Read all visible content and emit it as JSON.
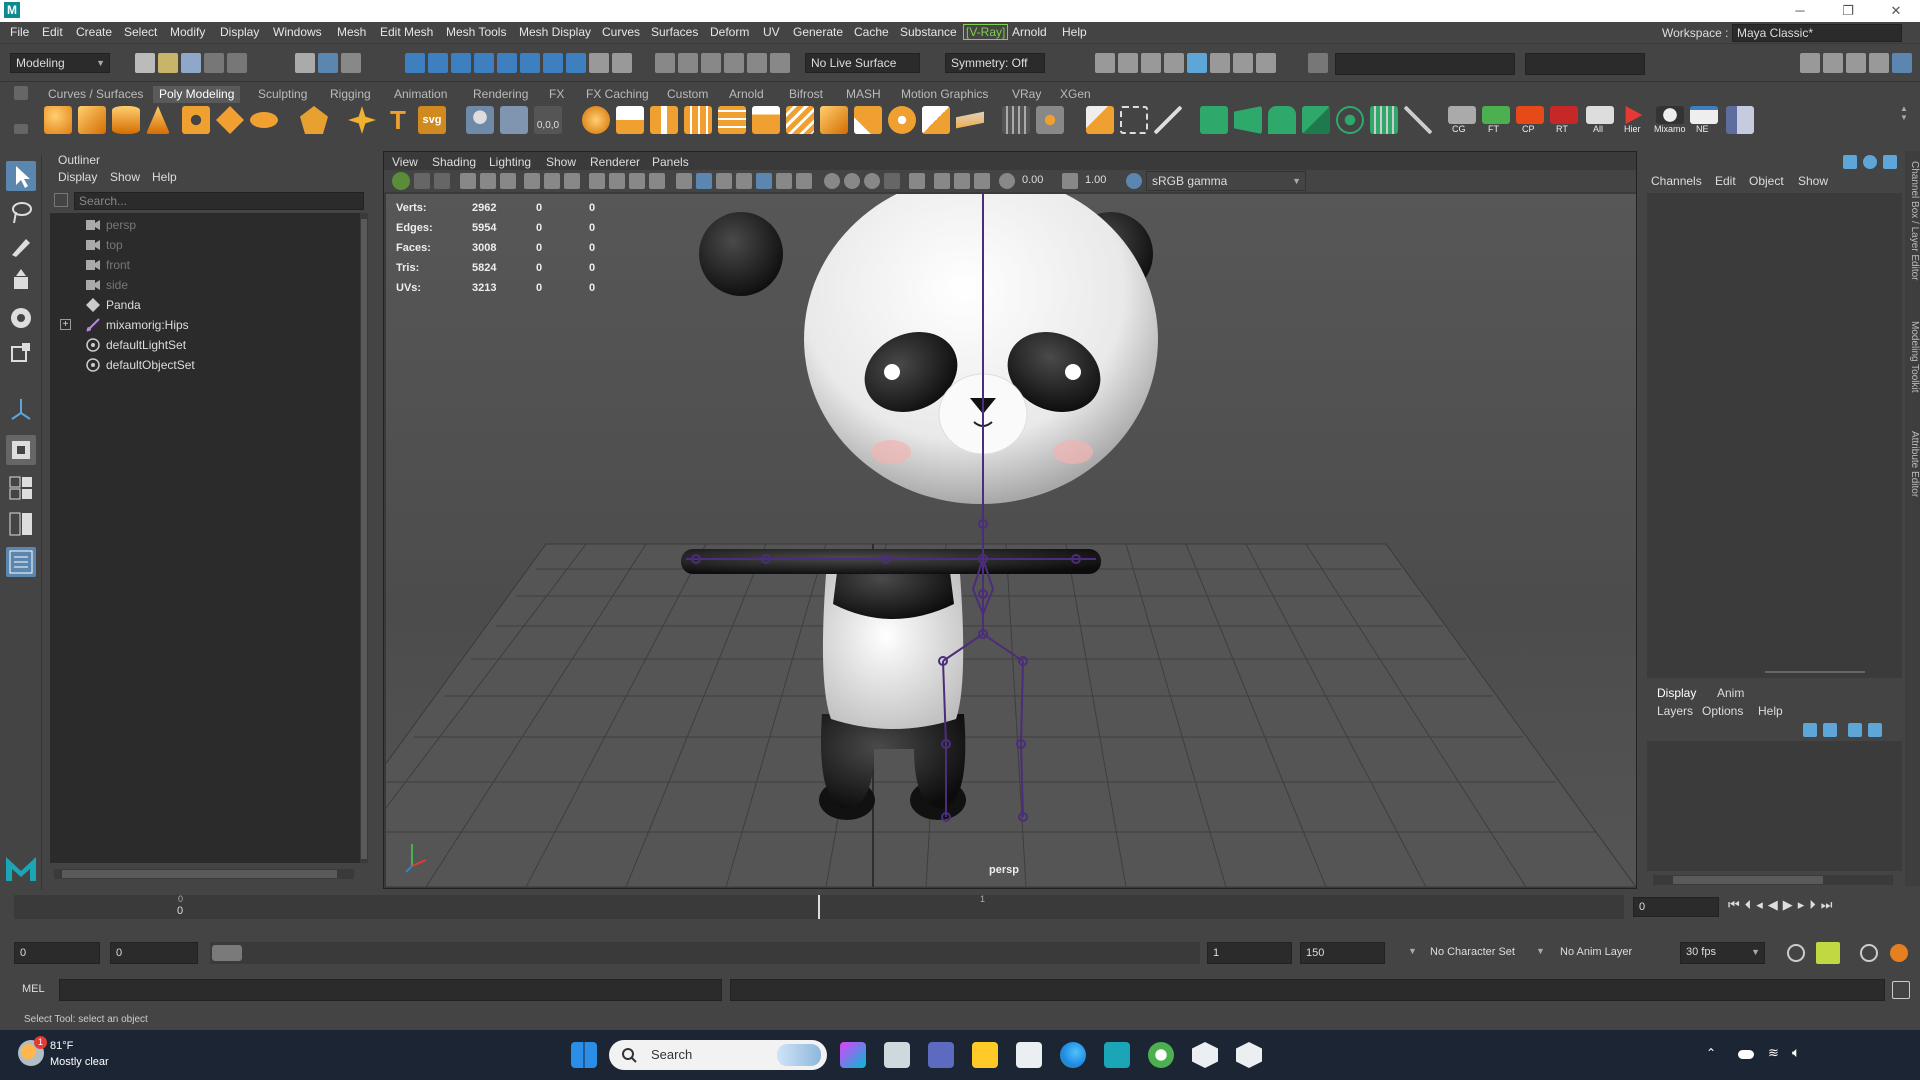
{
  "window": {
    "app_logo": "M",
    "controls": [
      "─",
      "❐",
      "✕"
    ]
  },
  "menubar": {
    "items": [
      "File",
      "Edit",
      "Create",
      "Select",
      "Modify",
      "Display",
      "Windows",
      "Mesh",
      "Edit Mesh",
      "Mesh Tools",
      "Mesh Display",
      "Curves",
      "Surfaces",
      "Deform",
      "UV",
      "Generate",
      "Cache",
      "Substance",
      "[V-Ray]",
      "Arnold",
      "Help"
    ],
    "workspace_label": "Workspace :",
    "workspace_value": "Maya Classic*"
  },
  "statusline": {
    "menuset": "Modeling",
    "live_surface": "No Live Surface",
    "symmetry": "Symmetry: Off"
  },
  "shelf": {
    "tabs": [
      "Curves / Surfaces",
      "Poly Modeling",
      "Sculpting",
      "Rigging",
      "Animation",
      "Rendering",
      "FX",
      "FX Caching",
      "Custom",
      "Arnold",
      "Bifrost",
      "MASH",
      "Motion Graphics",
      "VRay",
      "XGen"
    ],
    "active_tab": "Poly Modeling",
    "labeled_icons": [
      "CG",
      "FT",
      "CP",
      "RT",
      "All",
      "Hier",
      "Mixamo",
      "NE"
    ],
    "svg_label": "svg",
    "text_tool": "T",
    "coord_label": "0,0,0"
  },
  "outliner": {
    "title": "Outliner",
    "menus": [
      "Display",
      "Show",
      "Help"
    ],
    "search_placeholder": "Search...",
    "items": [
      {
        "name": "persp",
        "dim": true,
        "icon": "camera-icon"
      },
      {
        "name": "top",
        "dim": true,
        "icon": "camera-icon"
      },
      {
        "name": "front",
        "dim": true,
        "icon": "camera-icon"
      },
      {
        "name": "side",
        "dim": true,
        "icon": "camera-icon"
      },
      {
        "name": "Panda",
        "dim": false,
        "icon": "mesh-icon"
      },
      {
        "name": "mixamorig:Hips",
        "dim": false,
        "icon": "joint-icon"
      },
      {
        "name": "defaultLightSet",
        "dim": false,
        "icon": "set-icon"
      },
      {
        "name": "defaultObjectSet",
        "dim": false,
        "icon": "set-icon"
      }
    ]
  },
  "viewport": {
    "menus": [
      "View",
      "Shading",
      "Lighting",
      "Show",
      "Renderer",
      "Panels"
    ],
    "exposure": "0.00",
    "gamma": "1.00",
    "colorspace": "sRGB gamma",
    "camera_label": "persp",
    "hud": [
      {
        "label": "Verts:",
        "a": "2962",
        "b": "0",
        "c": "0"
      },
      {
        "label": "Edges:",
        "a": "5954",
        "b": "0",
        "c": "0"
      },
      {
        "label": "Faces:",
        "a": "3008",
        "b": "0",
        "c": "0"
      },
      {
        "label": "Tris:",
        "a": "5824",
        "b": "0",
        "c": "0"
      },
      {
        "label": "UVs:",
        "a": "3213",
        "b": "0",
        "c": "0"
      }
    ]
  },
  "channelbox": {
    "menus": [
      "Channels",
      "Edit",
      "Object",
      "Show"
    ],
    "layer_tabs": [
      "Display",
      "Anim"
    ],
    "layer_menus": [
      "Layers",
      "Options",
      "Help"
    ],
    "side_tabs": [
      "Channel Box / Layer Editor",
      "Modeling Toolkit",
      "Attribute Editor"
    ]
  },
  "timeline": {
    "start_marker": "0",
    "start_value": "0",
    "playhead_label": "1",
    "current_frame": "0"
  },
  "range": {
    "start": "0",
    "start2": "0",
    "end_start": "1",
    "end": "150",
    "character_set": "No Character Set",
    "anim_layer": "No Anim Layer",
    "fps": "30 fps"
  },
  "cmd": {
    "label": "MEL"
  },
  "help": {
    "text": "Select Tool: select an object"
  },
  "taskbar": {
    "temp": "81°F",
    "weather": "Mostly clear",
    "search": "Search",
    "badge": "1"
  },
  "colors": {
    "accent": "#5ea6d8",
    "vray": "#7fd04a",
    "active_tool": "#5a86b0"
  }
}
